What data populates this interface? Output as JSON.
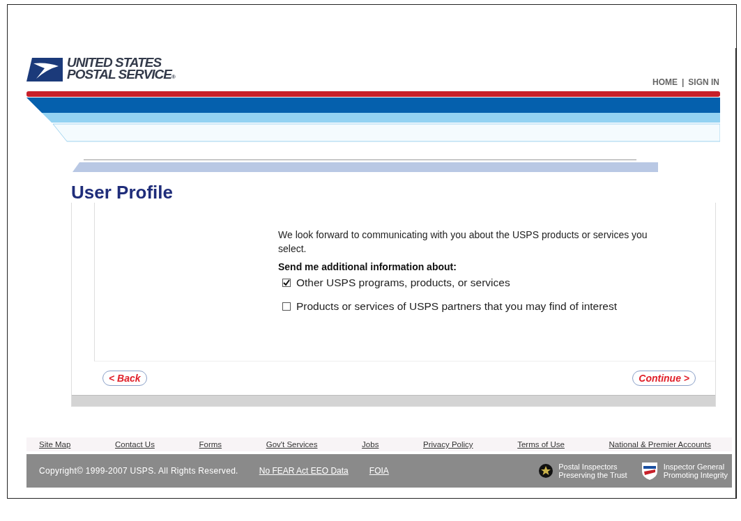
{
  "logo": {
    "line_1": "UNITED STATES",
    "line_2": "POSTAL SERVICE",
    "mark": "®"
  },
  "top_links": [
    "HOME",
    "SIGN IN"
  ],
  "top_separator": "|",
  "page_title": "User Profile",
  "intro": "We look forward to communicating with you about the USPS products or services you select.",
  "prompt": "Send me additional information about:",
  "options": [
    {
      "label": "Other USPS programs, products, or services",
      "checked": true
    },
    {
      "label": "Products or services of USPS partners that you may find of interest",
      "checked": false
    }
  ],
  "back_button": "< Back",
  "continue_button": "Continue >",
  "footer_links": [
    "Site Map",
    "Contact Us",
    "Forms",
    "Gov't Services",
    "Jobs",
    "Privacy Policy",
    "Terms of Use",
    "National & Premier Accounts"
  ],
  "copyright": "Copyright© 1999-2007 USPS. All Rights Reserved.",
  "legal_links": [
    "No FEAR Act EEO Data",
    "FOIA"
  ],
  "badges": [
    {
      "kind": "star",
      "line_1": "Postal Inspectors",
      "line_2": "Preserving the Trust"
    },
    {
      "kind": "shield",
      "line_1": "Inspector General",
      "line_2": "Promoting Integrity"
    }
  ]
}
